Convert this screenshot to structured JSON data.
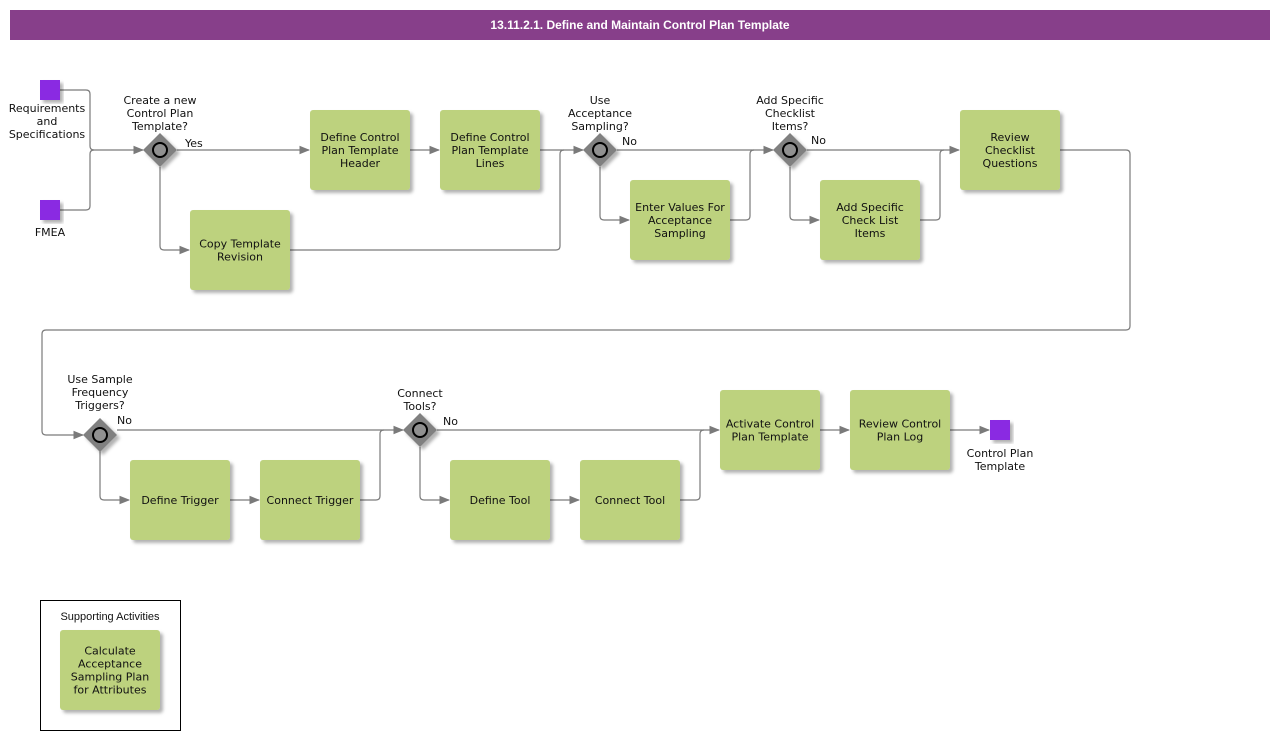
{
  "title": "13.11.2.1. Define and Maintain Control Plan Template",
  "colors": {
    "title_bar": "#873f8a",
    "task_fill": "#bdd27e",
    "event_fill": "#8a2be2",
    "gateway_fill": "#808080",
    "connector": "#7a7a7a"
  },
  "events": [
    {
      "id": "ev-req",
      "label": [
        "Requirements",
        "and",
        "Specifications"
      ]
    },
    {
      "id": "ev-fmea",
      "label": [
        "FMEA"
      ]
    },
    {
      "id": "ev-end",
      "label": [
        "Control Plan",
        "Template"
      ]
    }
  ],
  "gateways": [
    {
      "id": "gw1",
      "question": [
        "Create a new",
        "Control Plan",
        "Template?"
      ],
      "branch_label": "Yes"
    },
    {
      "id": "gw2",
      "question": [
        "Use",
        "Acceptance",
        "Sampling?"
      ],
      "branch_label": "No"
    },
    {
      "id": "gw3",
      "question": [
        "Add Specific",
        "Checklist",
        "Items?"
      ],
      "branch_label": "No"
    },
    {
      "id": "gw4",
      "question": [
        "Use Sample",
        "Frequency",
        "Triggers?"
      ],
      "branch_label": "No"
    },
    {
      "id": "gw5",
      "question": [
        "Connect",
        "Tools?"
      ],
      "branch_label": "No"
    }
  ],
  "tasks": [
    {
      "id": "t-header",
      "label": [
        "Define Control",
        "Plan Template",
        "Header"
      ]
    },
    {
      "id": "t-lines",
      "label": [
        "Define Control",
        "Plan Template",
        "Lines"
      ]
    },
    {
      "id": "t-copy",
      "label": [
        "Copy Template",
        "Revision"
      ]
    },
    {
      "id": "t-accept",
      "label": [
        "Enter Values For",
        "Acceptance",
        "Sampling"
      ]
    },
    {
      "id": "t-checkitems",
      "label": [
        "Add Specific",
        "Check List",
        "Items"
      ]
    },
    {
      "id": "t-review-q",
      "label": [
        "Review",
        "Checklist",
        "Questions"
      ]
    },
    {
      "id": "t-def-trigger",
      "label": [
        "Define Trigger"
      ]
    },
    {
      "id": "t-conn-trigger",
      "label": [
        "Connect Trigger"
      ]
    },
    {
      "id": "t-def-tool",
      "label": [
        "Define Tool"
      ]
    },
    {
      "id": "t-conn-tool",
      "label": [
        "Connect Tool"
      ]
    },
    {
      "id": "t-activate",
      "label": [
        "Activate Control",
        "Plan Template"
      ]
    },
    {
      "id": "t-review-log",
      "label": [
        "Review Control",
        "Plan Log"
      ]
    }
  ],
  "supporting": {
    "title": "Supporting Activities",
    "tasks": [
      {
        "id": "s-calc",
        "label": [
          "Calculate",
          "Acceptance",
          "Sampling Plan",
          "for Attributes"
        ]
      }
    ]
  }
}
